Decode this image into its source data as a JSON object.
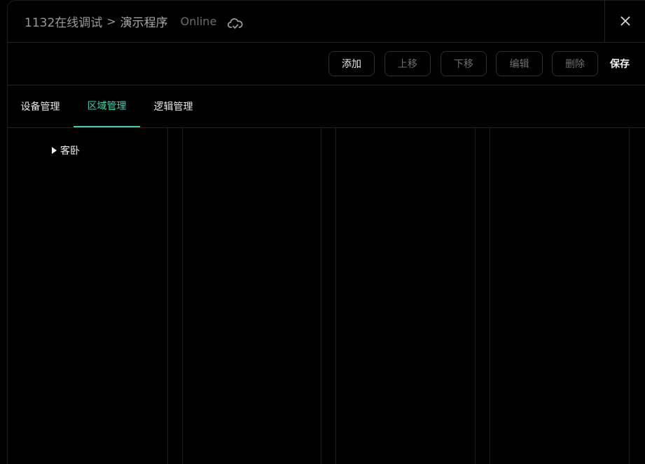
{
  "titlebar": {
    "breadcrumb_root": "1132在线调试",
    "breadcrumb_separator": ">",
    "breadcrumb_current": "演示程序",
    "status": "Online",
    "status_icon": "cloud-sync-icon",
    "close_icon": "close-icon"
  },
  "toolbar": {
    "add_label": "添加",
    "move_up_label": "上移",
    "move_down_label": "下移",
    "edit_label": "编辑",
    "delete_label": "删除",
    "save_label": "保存"
  },
  "tabs": [
    {
      "label": "设备管理",
      "active": false
    },
    {
      "label": "区域管理",
      "active": true
    },
    {
      "label": "逻辑管理",
      "active": false
    }
  ],
  "tree": {
    "items": [
      {
        "label": "客卧",
        "expanded": false
      }
    ]
  },
  "colors": {
    "background": "#000000",
    "accent": "#3bd1b0",
    "border": "#222222",
    "text_primary": "#e8e8e8",
    "text_muted": "#6f6f6f"
  }
}
